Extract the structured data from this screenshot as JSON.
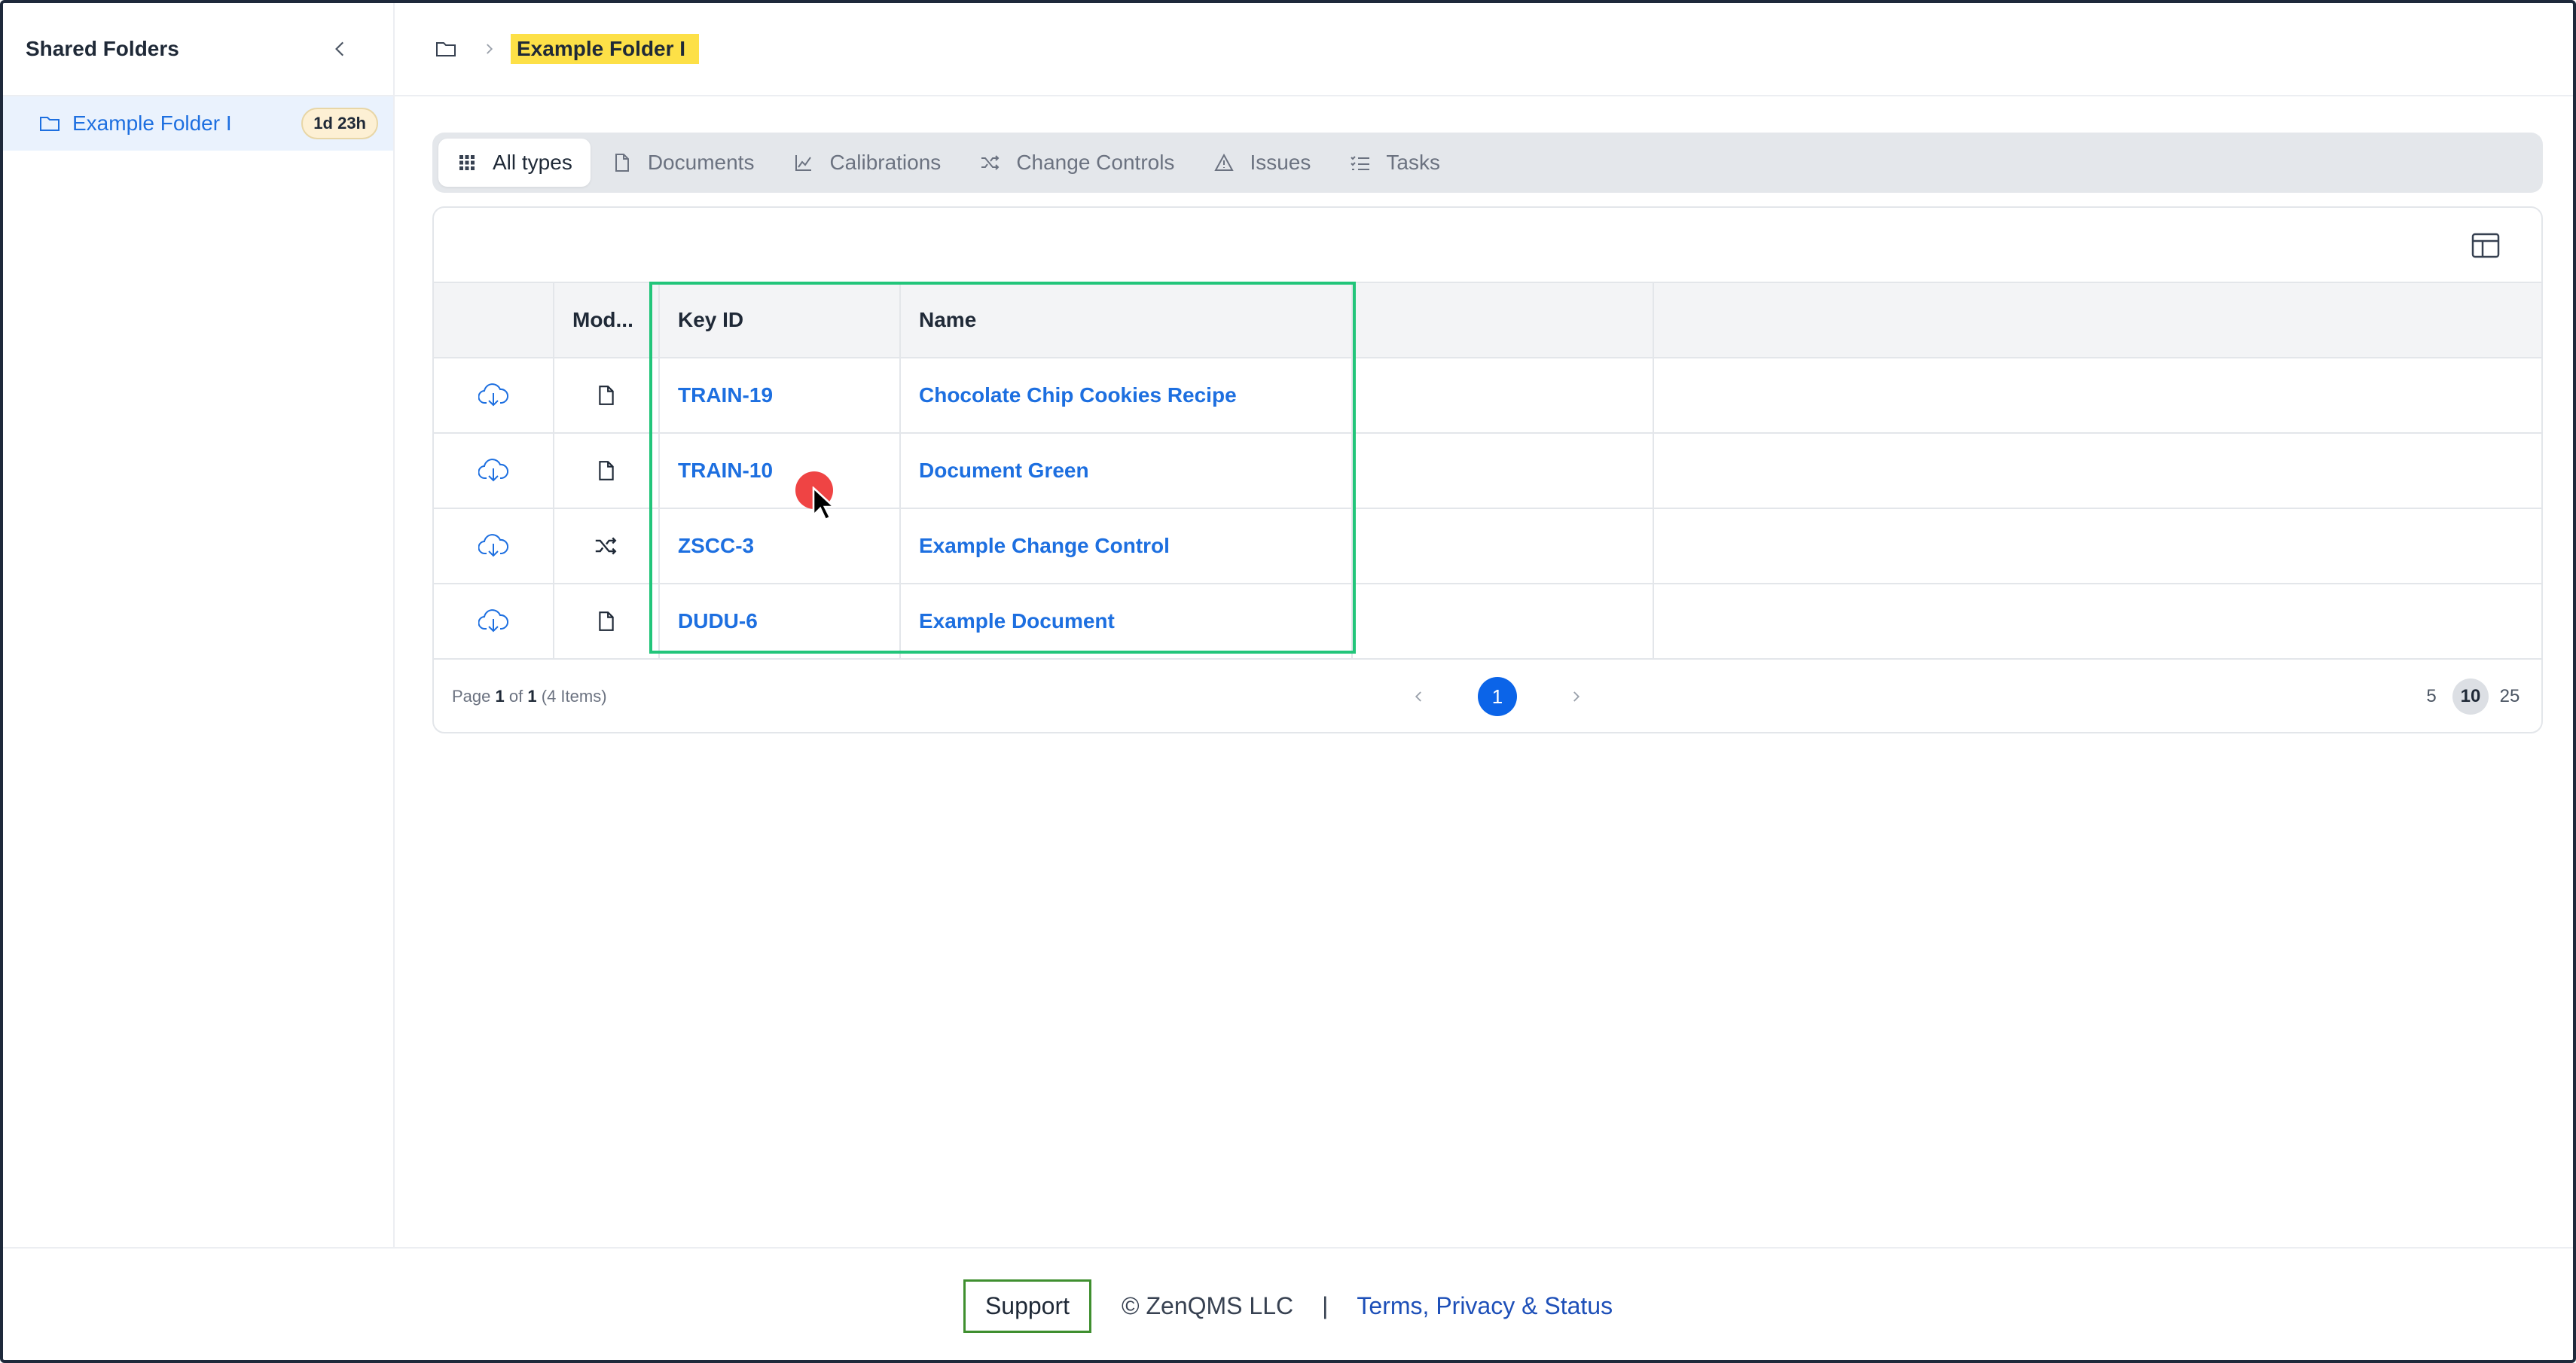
{
  "sidebar": {
    "title": "Shared Folders",
    "folders": [
      {
        "label": "Example Folder I",
        "badge": "1d 23h"
      }
    ]
  },
  "breadcrumb": {
    "current": "Example Folder I"
  },
  "tabs": [
    {
      "label": "All types",
      "icon": "grid-icon",
      "active": true
    },
    {
      "label": "Documents",
      "icon": "document-icon",
      "active": false
    },
    {
      "label": "Calibrations",
      "icon": "chart-icon",
      "active": false
    },
    {
      "label": "Change Controls",
      "icon": "shuffle-icon",
      "active": false
    },
    {
      "label": "Issues",
      "icon": "warning-icon",
      "active": false
    },
    {
      "label": "Tasks",
      "icon": "checklist-icon",
      "active": false
    }
  ],
  "table": {
    "columns": [
      "",
      "Mod...",
      "Key ID",
      "Name",
      "",
      ""
    ],
    "rows": [
      {
        "module_icon": "document-icon",
        "key_id": "TRAIN-19",
        "name": "Chocolate Chip Cookies Recipe"
      },
      {
        "module_icon": "document-icon",
        "key_id": "TRAIN-10",
        "name": "Document Green"
      },
      {
        "module_icon": "shuffle-icon",
        "key_id": "ZSCC-3",
        "name": "Example Change Control"
      },
      {
        "module_icon": "document-icon",
        "key_id": "DUDU-6",
        "name": "Example Document"
      }
    ]
  },
  "pagination": {
    "page_prefix": "Page",
    "current": "1",
    "of_label": "of",
    "total_pages": "1",
    "items_label": "(4 Items)",
    "page_button": "1",
    "sizes": [
      "5",
      "10",
      "25"
    ],
    "active_size": "10"
  },
  "footer": {
    "support": "Support",
    "copyright": "© ZenQMS LLC",
    "divider": "|",
    "terms": "Terms, Privacy & Status"
  },
  "colors": {
    "accent": "#1d6fe0",
    "highlight_box": "#22c57a",
    "breadcrumb_highlight": "#fde047",
    "page_active": "#0b64e8"
  }
}
